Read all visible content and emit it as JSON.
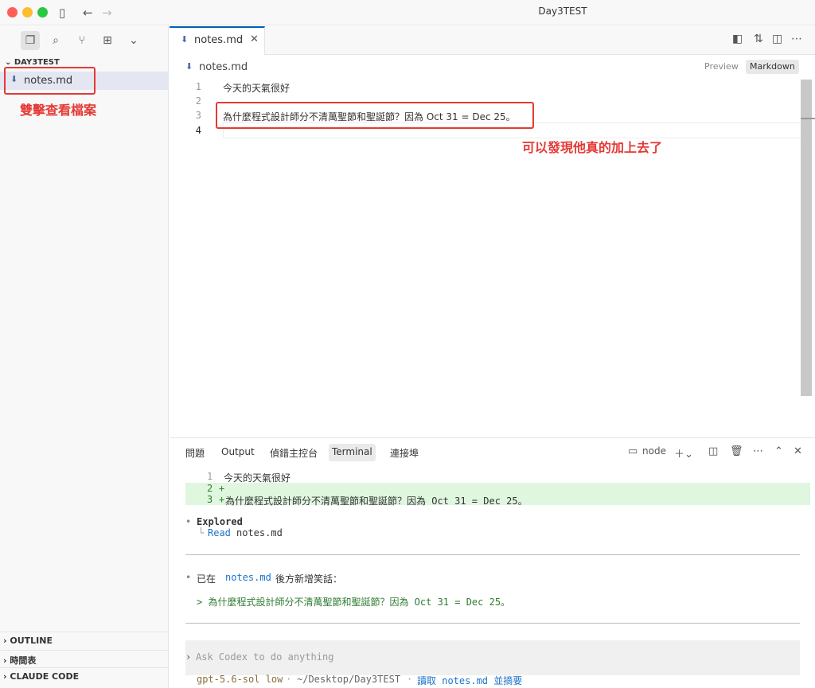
{
  "window": {
    "title": "Day3TEST",
    "colors": {
      "accent": "#005fb8",
      "annotation": "#e53935",
      "diff_added_bg": "#dff7df",
      "link": "#1a73c8",
      "quote": "#2e7d32"
    }
  },
  "sidebar": {
    "section_title": "DAY3TEST",
    "file_name": "notes.md",
    "bottom_sections": [
      "OUTLINE",
      "時間表",
      "CLAUDE CODE"
    ]
  },
  "editor": {
    "tab_label": "notes.md",
    "breadcrumb": "notes.md",
    "modes": [
      "Preview",
      "Markdown"
    ],
    "selected_mode": "Markdown",
    "lines": [
      {
        "num": "1",
        "text": "今天的天氣很好"
      },
      {
        "num": "2",
        "text": ""
      },
      {
        "num": "3",
        "text": "為什麼程式設計師分不清萬聖節和聖誕節？因為 Oct 31 = Dec 25。"
      },
      {
        "num": "4",
        "text": ""
      }
    ]
  },
  "annotations": {
    "sidebar_note": "雙擊查看檔案",
    "editor_note": "可以發現他真的加上去了"
  },
  "panel": {
    "tabs": [
      "問題",
      "Output",
      "偵錯主控台",
      "Terminal",
      "連接埠"
    ],
    "active_tab": "Terminal",
    "terminal_name": "node",
    "diff": [
      {
        "num": "1",
        "mark": " ",
        "text": "今天的天氣很好"
      },
      {
        "num": "2",
        "mark": "+",
        "text": ""
      },
      {
        "num": "3",
        "mark": "+",
        "text": "為什麼程式設計師分不清萬聖節和聖誕節？因為 Oct 31 = Dec 25。"
      }
    ],
    "explored_label": "Explored",
    "read_label": "Read",
    "read_file": "notes.md",
    "summary_prefix": "已在",
    "summary_file": "notes.md",
    "summary_suffix": "後方新增笑話：",
    "quote_text": "> 為什麼程式設計師分不清萬聖節和聖誕節？因為 Oct 31 = Dec 25。",
    "input_placeholder": "Ask Codex to do anything",
    "status_model": "gpt-5.6-sol low",
    "status_path": "~/Desktop/Day3TEST",
    "status_hint": "讀取 notes.md 並摘要"
  }
}
